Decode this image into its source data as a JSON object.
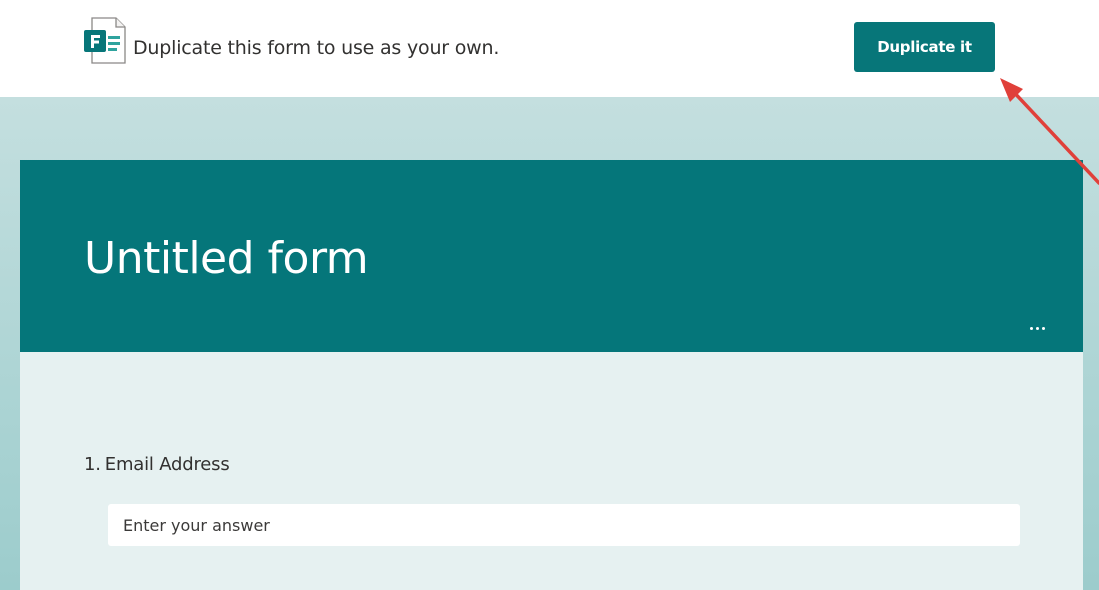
{
  "banner": {
    "logo_icon": "microsoft-forms-icon",
    "message": "Duplicate this form to use as your own.",
    "duplicate_label": "Duplicate it"
  },
  "form": {
    "title": "Untitled form",
    "more_icon": "ellipsis-icon",
    "questions": [
      {
        "number": "1.",
        "label": "Email Address",
        "placeholder": "Enter your answer",
        "value": ""
      }
    ]
  },
  "colors": {
    "accent": "#077679",
    "header": "#05767a",
    "card_body": "#e6f1f1",
    "backdrop": "#acd4d4",
    "annotation_arrow": "#e0403a"
  }
}
